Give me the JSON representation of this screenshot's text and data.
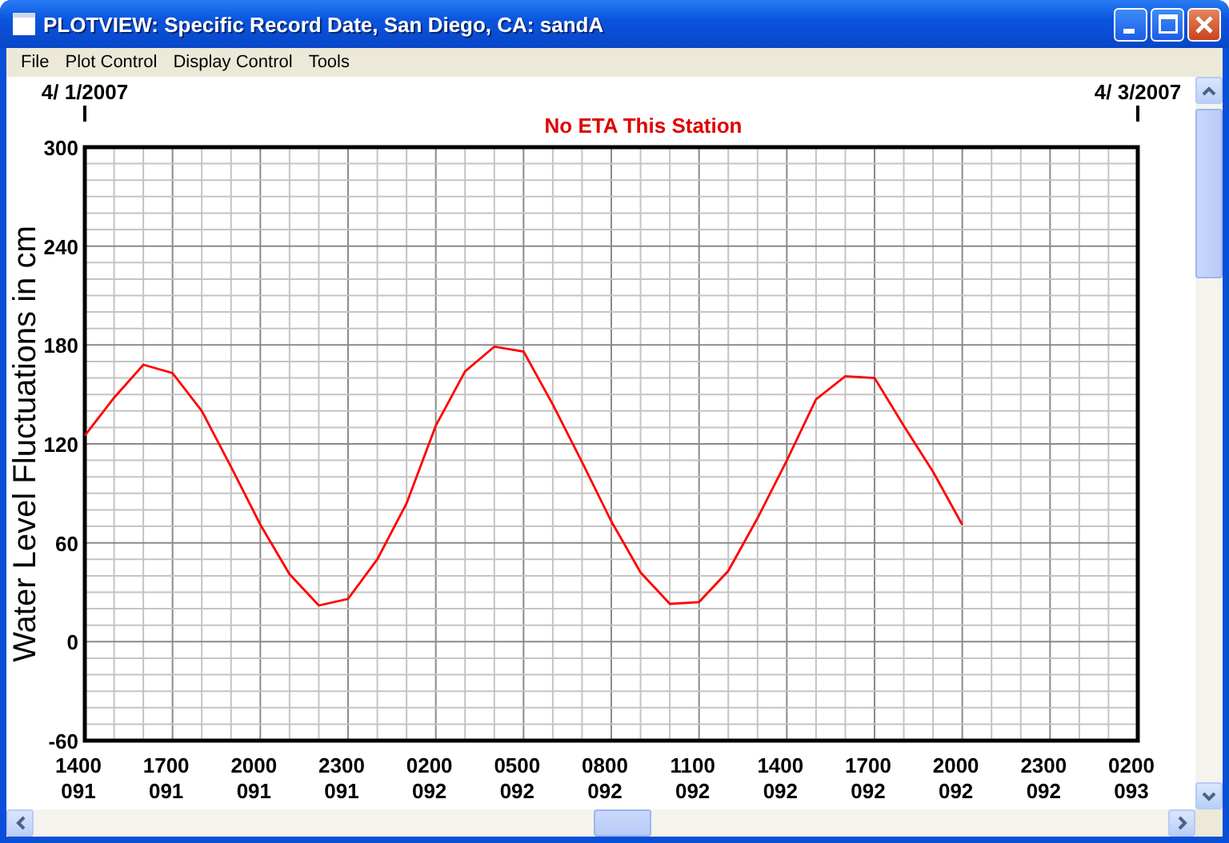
{
  "window": {
    "title": "PLOTVIEW: Specific Record Date, San Diego, CA: sandA"
  },
  "menu": [
    "File",
    "Plot Control",
    "Display Control",
    "Tools"
  ],
  "chart": {
    "chart_data": {
      "type": "line",
      "title": "No ETA This Station",
      "ylabel": "Water Level Fluctuations in cm",
      "categories": [
        "1400 091",
        null,
        null,
        "1700 091",
        null,
        null,
        "2000 091",
        null,
        null,
        "2300 091",
        null,
        null,
        "0200 092",
        null,
        null,
        "0500 092",
        null,
        null,
        "0800 092",
        null,
        null,
        "1100 092",
        null,
        null,
        "1400 092",
        null,
        null,
        "1700 092",
        null,
        null,
        "2000 092",
        null,
        null,
        "2300 092",
        null,
        null,
        "0200 093"
      ],
      "series": [
        {
          "color": "#ff0000",
          "values": [
            125,
            148,
            168,
            163,
            140,
            106,
            71,
            41,
            22,
            26,
            50,
            84,
            131,
            164,
            179,
            176,
            144,
            109,
            73,
            42,
            23,
            24,
            43,
            75,
            110,
            147,
            161,
            160,
            131,
            103,
            71,
            null,
            null,
            null,
            null,
            null,
            null
          ]
        }
      ],
      "ylim": [
        -60,
        300
      ],
      "grid": true,
      "yticks": [
        -60,
        0,
        60,
        120,
        180,
        240,
        300
      ],
      "annotations": [
        "4/ 1/2007",
        "4/ 3/2007"
      ]
    }
  }
}
